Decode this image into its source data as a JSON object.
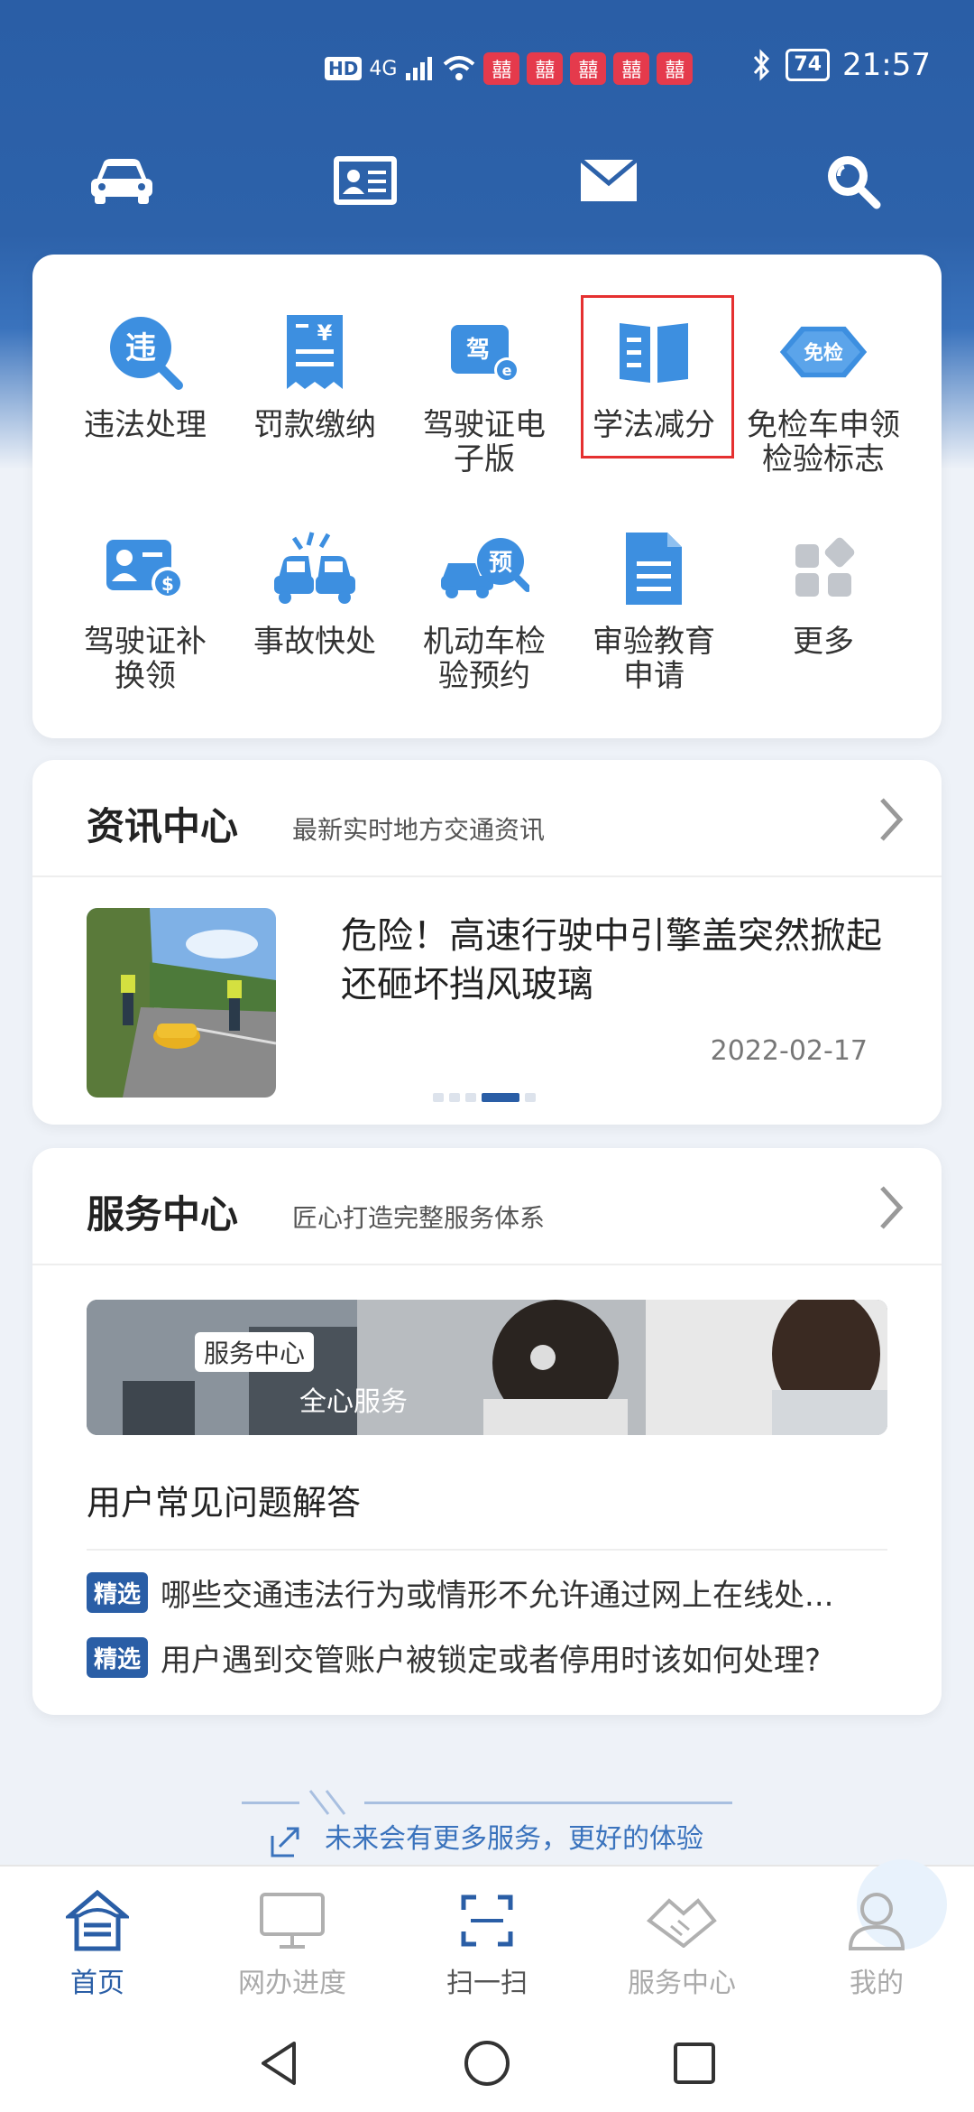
{
  "status": {
    "left_badge": "HD",
    "signal": "4G",
    "battery": "74",
    "time": "21:57",
    "heart_glyph": "囍"
  },
  "grid": {
    "items": [
      {
        "label_line1": "违法处理",
        "label_line2": "",
        "icon": "violation-icon",
        "icon_text": "违"
      },
      {
        "label_line1": "罚款缴纳",
        "label_line2": "",
        "icon": "fine-bill-icon",
        "icon_text": "¥"
      },
      {
        "label_line1": "驾驶证电",
        "label_line2": "子版",
        "icon": "e-license-icon",
        "icon_text": "驾"
      },
      {
        "label_line1": "学法减分",
        "label_line2": "",
        "icon": "open-book-icon",
        "icon_text": ""
      },
      {
        "label_line1": "免检车申领",
        "label_line2": "检验标志",
        "icon": "exempt-inspection-icon",
        "icon_text": "免检"
      },
      {
        "label_line1": "驾驶证补",
        "label_line2": "换领",
        "icon": "license-replace-icon",
        "icon_text": "$"
      },
      {
        "label_line1": "事故快处",
        "label_line2": "",
        "icon": "accident-icon",
        "icon_text": ""
      },
      {
        "label_line1": "机动车检",
        "label_line2": "验预约",
        "icon": "inspection-appointment-icon",
        "icon_text": "预"
      },
      {
        "label_line1": "审验教育",
        "label_line2": "申请",
        "icon": "document-icon",
        "icon_text": ""
      },
      {
        "label_line1": "更多",
        "label_line2": "",
        "icon": "more-grid-icon",
        "icon_text": ""
      }
    ]
  },
  "news": {
    "title": "资讯中心",
    "subtitle": "最新实时地方交通资讯",
    "headline": "危险！高速行驶中引擎盖突然掀起还砸坏挡风玻璃",
    "date": "2022-02-17",
    "carousel_active_index": 3,
    "carousel_count": 5
  },
  "service": {
    "title": "服务中心",
    "subtitle": "匠心打造完整服务体系",
    "banner_tag": "服务中心",
    "banner_text": "全心服务",
    "faq_title": "用户常见问题解答",
    "faq": [
      {
        "badge": "精选",
        "text": "哪些交通违法行为或情形不允许通过网上在线处..."
      },
      {
        "badge": "精选",
        "text": "用户遇到交管账户被锁定或者停用时该如何处理?"
      }
    ]
  },
  "footer_promo": "未来会有更多服务，更好的体验",
  "bottom_nav": [
    {
      "label": "首页",
      "icon": "home-icon",
      "active": true
    },
    {
      "label": "网办进度",
      "icon": "monitor-icon",
      "active": false
    },
    {
      "label": "扫一扫",
      "icon": "scan-icon",
      "active": false
    },
    {
      "label": "服务中心",
      "icon": "handshake-icon",
      "active": false
    },
    {
      "label": "我的",
      "icon": "user-icon",
      "active": false
    }
  ],
  "colors": {
    "primary": "#2a5ea6",
    "accent_blue": "#3d8fe0",
    "highlight_border": "#e53030"
  }
}
